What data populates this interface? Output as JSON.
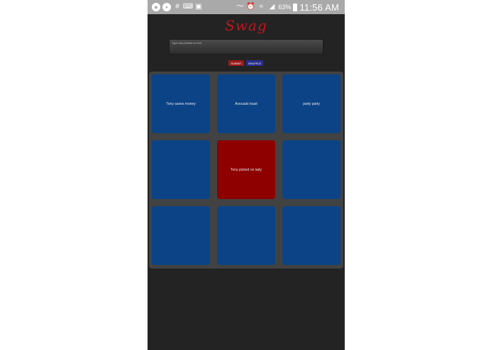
{
  "status_bar": {
    "battery_percent": "63%",
    "time": "11:56 AM",
    "left_icons": [
      "person-icon",
      "chat-icon",
      "hash-icon",
      "keyboard-icon",
      "briefcase-icon"
    ],
    "right_icons": [
      "vibrate-icon",
      "alarm-icon",
      "wifi-icon",
      "signal-icon",
      "battery-icon"
    ]
  },
  "app": {
    "logo_text": "Swag",
    "input_text": "Type any phrase or text",
    "buttons": {
      "red": "SUBMIT",
      "blue": "SHUFFLE"
    }
  },
  "board": {
    "tiles": [
      {
        "text": "Tony saves money",
        "color": "#0b4386"
      },
      {
        "text": "Avocado toast",
        "color": "#0b4386"
      },
      {
        "text": "party party",
        "color": "#0b4386"
      },
      {
        "text": "",
        "color": "#0b4386"
      },
      {
        "text": "Tony picked on lady",
        "color": "#8e0000"
      },
      {
        "text": "",
        "color": "#0b4386"
      },
      {
        "text": "",
        "color": "#0b4386"
      },
      {
        "text": "",
        "color": "#0b4386"
      },
      {
        "text": "",
        "color": "#0b4386"
      }
    ]
  },
  "colors": {
    "background": "#232323",
    "board": "#424242",
    "tile_blue": "#0b4386",
    "tile_red": "#8e0000",
    "logo": "#c4161c"
  }
}
